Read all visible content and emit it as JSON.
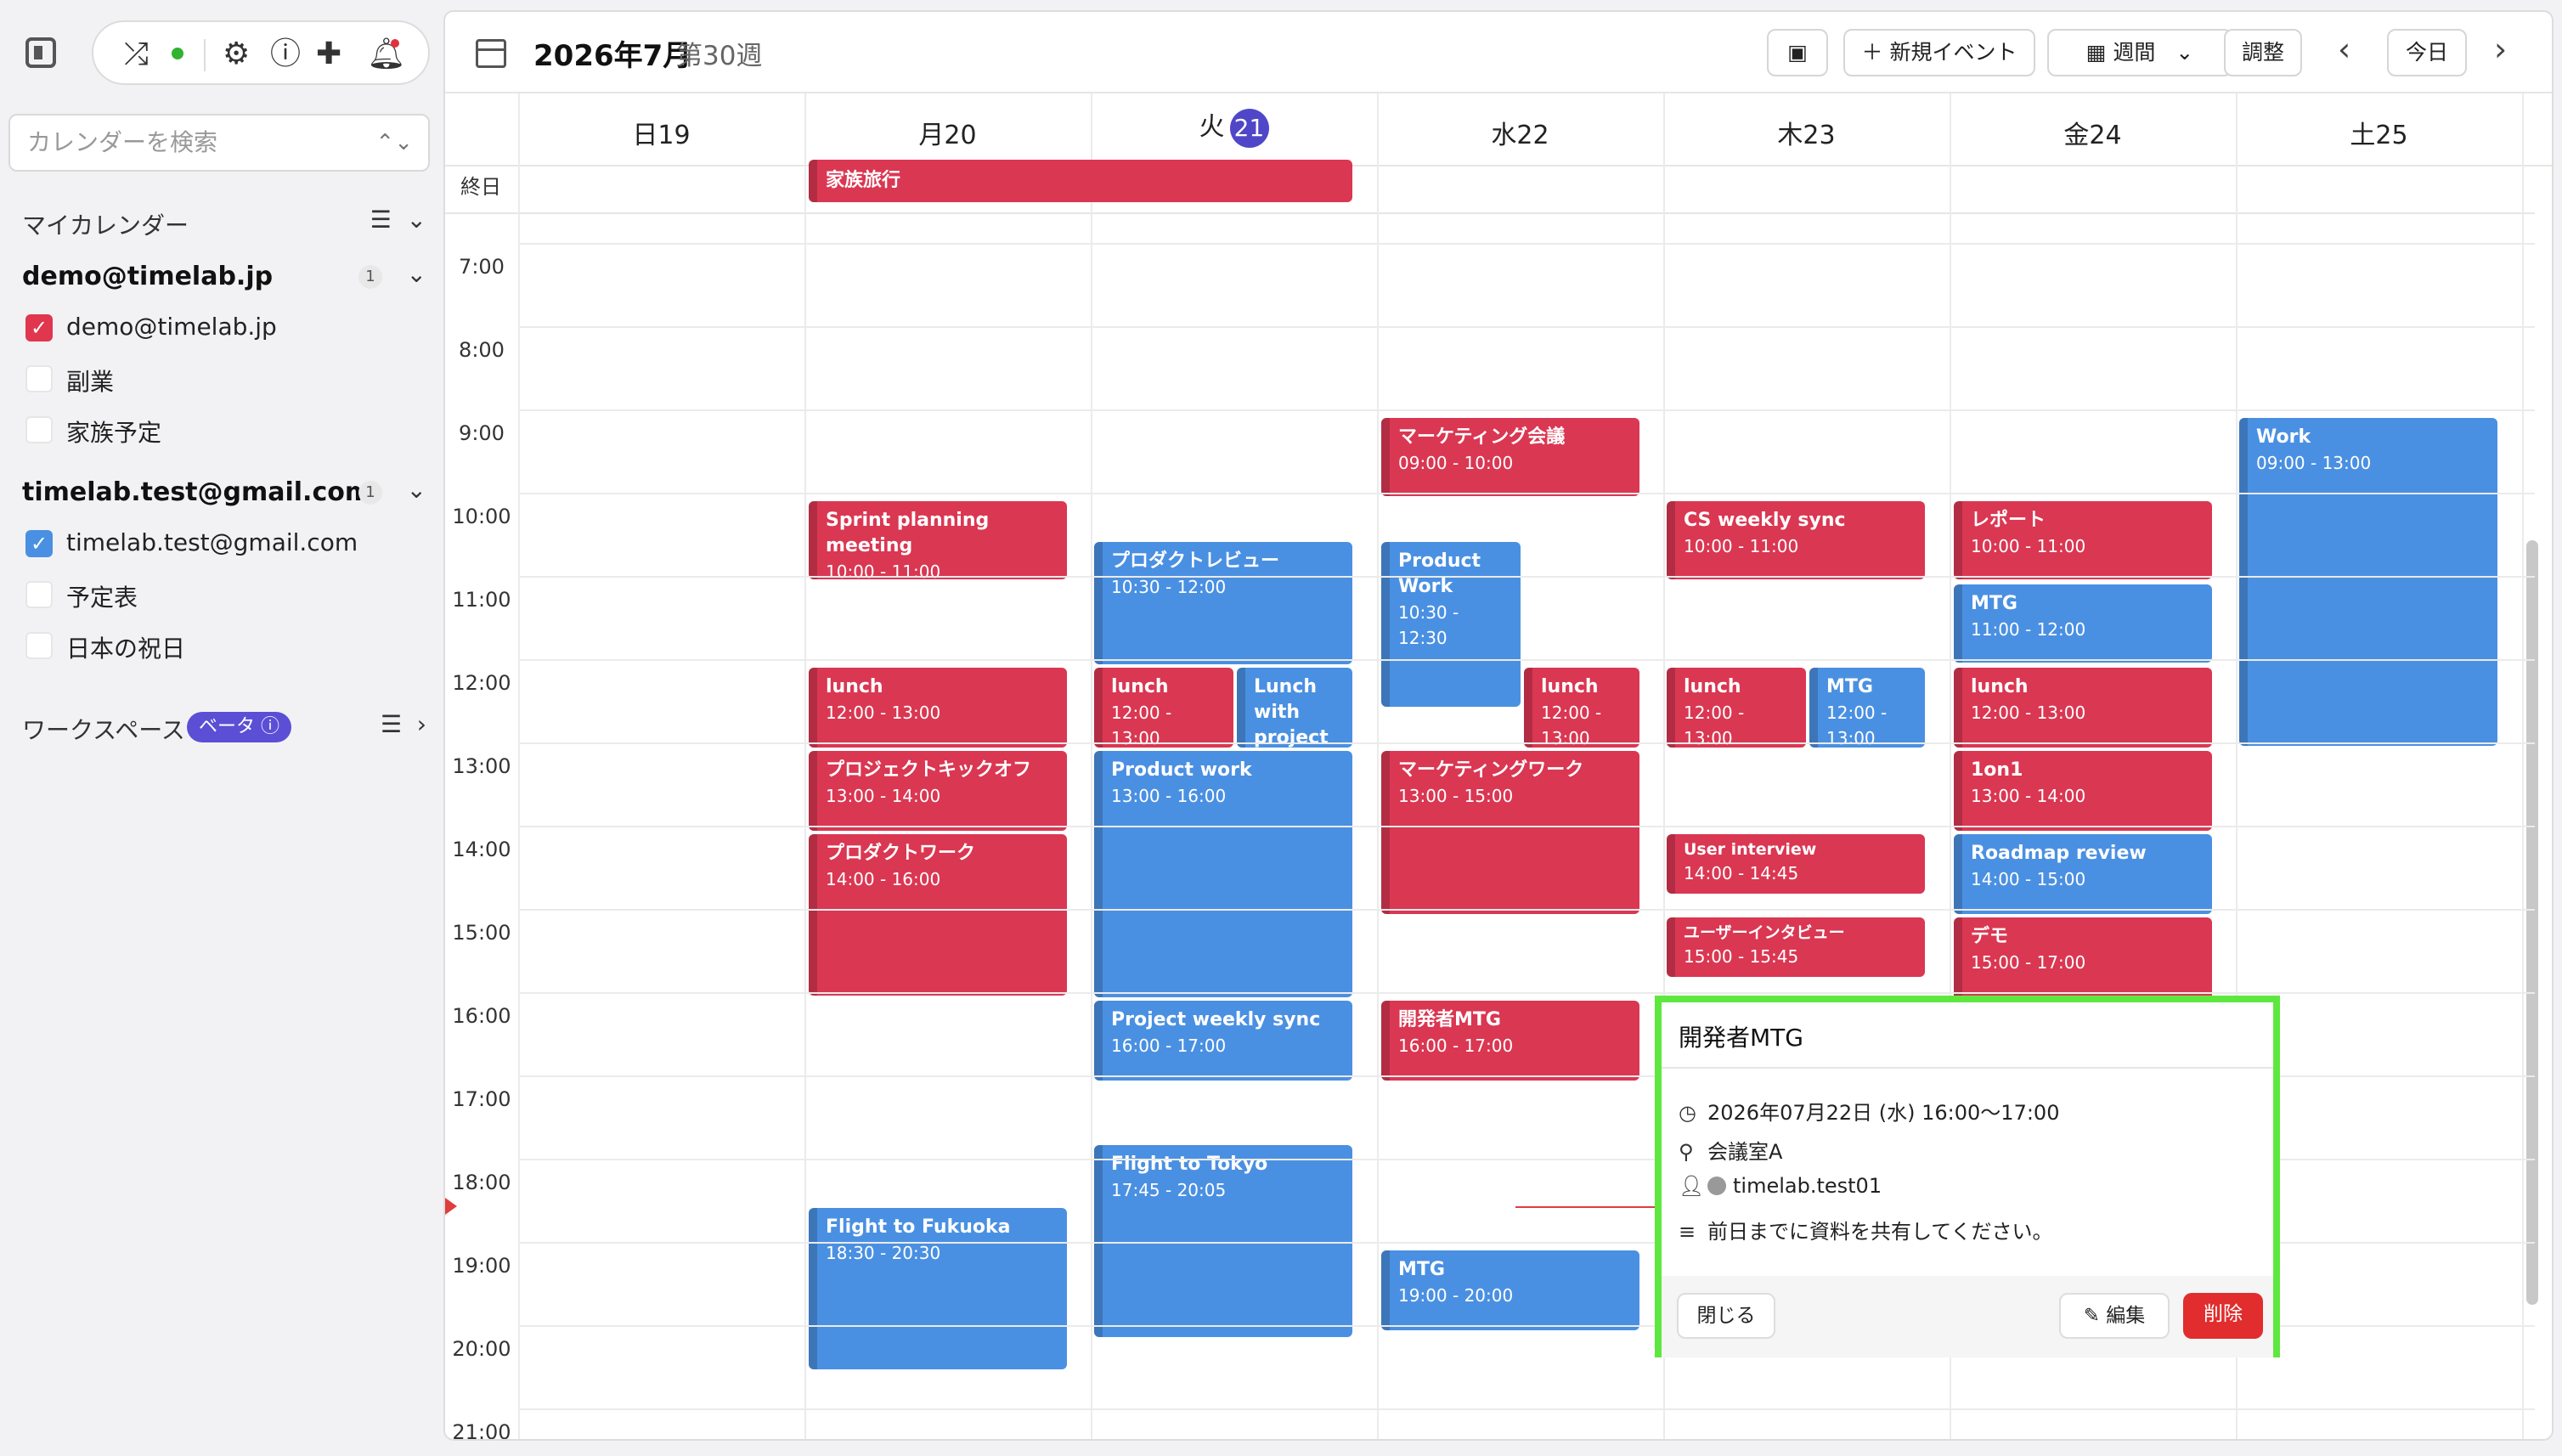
{
  "sidebar": {
    "search_placeholder": "カレンダーを検索",
    "my_calendars_title": "マイカレンダー",
    "accounts": [
      {
        "email": "demo@timelab.jp",
        "count": "1",
        "calendars": [
          {
            "label": "demo@timelab.jp",
            "checked": true,
            "color": "#e0364e"
          },
          {
            "label": "副業",
            "checked": false
          },
          {
            "label": "家族予定",
            "checked": false
          }
        ]
      },
      {
        "email": "timelab.test@gmail.com",
        "count": "1",
        "calendars": [
          {
            "label": "timelab.test@gmail.com",
            "checked": true,
            "color": "#4a90e2"
          },
          {
            "label": "予定表",
            "checked": false
          },
          {
            "label": "日本の祝日",
            "checked": false
          }
        ]
      }
    ],
    "workspace_title": "ワークスペース",
    "beta_label": "ベータ"
  },
  "header": {
    "title": "2026年7月",
    "week_label": "第30週",
    "new_event_label": "新規イベント",
    "view_label": "週間",
    "adjust_label": "調整",
    "today_label": "今日"
  },
  "days": [
    {
      "label": "日19"
    },
    {
      "label": "月20"
    },
    {
      "label": "火",
      "num": "21",
      "today": true
    },
    {
      "label": "水22"
    },
    {
      "label": "木23"
    },
    {
      "label": "金24"
    },
    {
      "label": "土25"
    }
  ],
  "allday_label": "終日",
  "times": [
    "7:00",
    "8:00",
    "9:00",
    "10:00",
    "11:00",
    "12:00",
    "13:00",
    "14:00",
    "15:00",
    "16:00",
    "17:00",
    "18:00",
    "19:00",
    "20:00",
    "21:00"
  ],
  "events": {
    "allday": {
      "title": "家族旅行"
    },
    "e01": {
      "title": "Sprint planning meeting",
      "time": "10:00 - 11:00"
    },
    "e02": {
      "title": "lunch",
      "time": "12:00 - 13:00"
    },
    "e03": {
      "title": "プロジェクトキックオフ",
      "time": "13:00 - 14:00"
    },
    "e04": {
      "title": "プロダクトワーク",
      "time": "14:00 - 16:00"
    },
    "e05": {
      "title": "Flight to Fukuoka",
      "time": "18:30 - 20:30"
    },
    "e06": {
      "title": "プロダクトレビュー",
      "time": "10:30 - 12:00"
    },
    "e07": {
      "title": "lunch",
      "time": "12:00 - 13:00"
    },
    "e08": {
      "title": "Lunch with project"
    },
    "e09": {
      "title": "Product work",
      "time": "13:00 - 16:00"
    },
    "e10": {
      "title": "Project weekly sync",
      "time": "16:00 - 17:00"
    },
    "e11": {
      "title": "Flight to Tokyo",
      "time": "17:45 - 20:05"
    },
    "e12": {
      "title": "マーケティング会議",
      "time": "09:00 - 10:00"
    },
    "e13": {
      "title": "Product Work",
      "time": "10:30 - 12:30"
    },
    "e14": {
      "title": "lunch",
      "time": "12:00 - 13:00"
    },
    "e15": {
      "title": "マーケティングワーク",
      "time": "13:00 - 15:00"
    },
    "e16": {
      "title": "開発者MTG",
      "time": "16:00 - 17:00"
    },
    "e17": {
      "title": "MTG",
      "time": "19:00 - 20:00"
    },
    "e18": {
      "title": "CS weekly sync",
      "time": "10:00 - 11:00"
    },
    "e19": {
      "title": "lunch",
      "time": "12:00 - 13:00"
    },
    "e20": {
      "title": "MTG",
      "time": "12:00 - 13:00"
    },
    "e21": {
      "title": "User interview",
      "time": "14:00 - 14:45"
    },
    "e22": {
      "title": "ユーザーインタビュー",
      "time": "15:00 - 15:45"
    },
    "e23": {
      "title": "レポート",
      "time": "10:00 - 11:00"
    },
    "e24": {
      "title": "MTG",
      "time": "11:00 - 12:00"
    },
    "e25": {
      "title": "lunch",
      "time": "12:00 - 13:00"
    },
    "e26": {
      "title": "1on1",
      "time": "13:00 - 14:00"
    },
    "e27": {
      "title": "Roadmap review",
      "time": "14:00 - 15:00"
    },
    "e28": {
      "title": "デモ",
      "time": "15:00 - 17:00"
    },
    "e29": {
      "title": "Work",
      "time": "09:00 - 13:00"
    }
  },
  "popup": {
    "title": "開発者MTG",
    "datetime": "2026年07月22日 (水) 16:00〜17:00",
    "location": "会議室A",
    "attendee": "timelab.test01",
    "description": "前日までに資料を共有してください。",
    "close_label": "閉じる",
    "edit_label": "編集",
    "delete_label": "削除"
  },
  "colors": {
    "red": "#da3752",
    "blue": "#4a90e2",
    "accent": "#5046c8",
    "highlight": "#5ee83f"
  }
}
